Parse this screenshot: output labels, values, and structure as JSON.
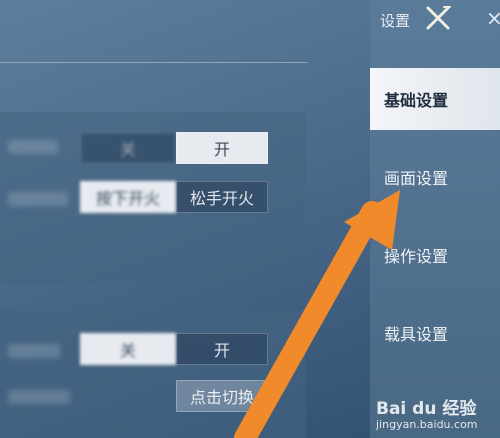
{
  "header": {
    "title": "设置"
  },
  "sidebar": {
    "items": [
      {
        "label": "基础设置",
        "active": true
      },
      {
        "label": "画面设置",
        "active": false
      },
      {
        "label": "操作设置",
        "active": false
      },
      {
        "label": "载具设置",
        "active": false
      }
    ]
  },
  "settings": {
    "row1": {
      "off_label": "关",
      "on_label": "开"
    },
    "row2": {
      "option_a": "按下开火",
      "option_b": "松手开火"
    },
    "row3": {
      "off_label": "关",
      "on_label": "开"
    },
    "row4": {
      "button_label": "点击切换"
    }
  },
  "watermark": {
    "text": "Bai du 经验",
    "sub": "jingyan.baidu.com"
  },
  "colors": {
    "arrow": "#f08a2a",
    "accent_bg": "#e7ebf0"
  }
}
